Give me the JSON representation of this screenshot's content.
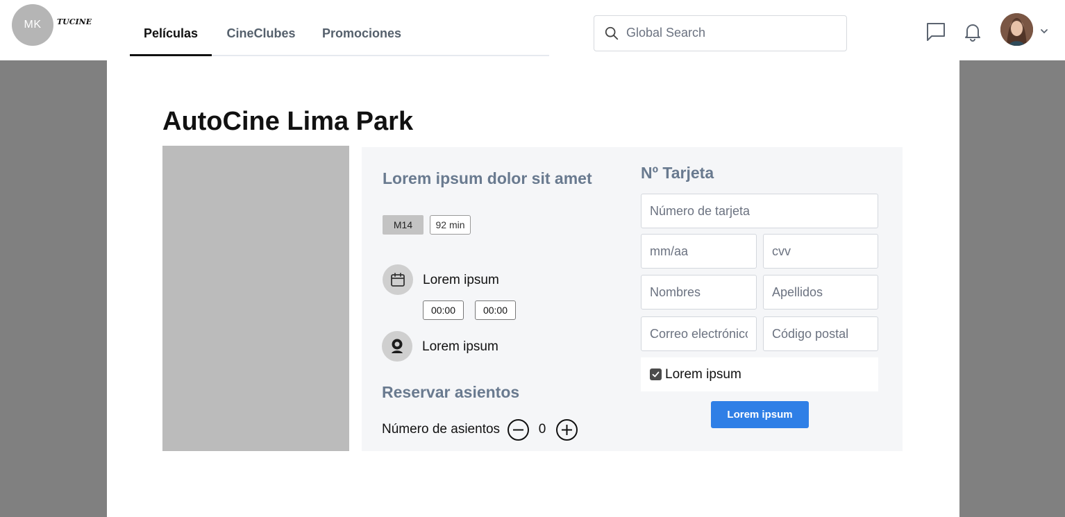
{
  "header": {
    "logo_initials": "MK",
    "brand": "TUCINE",
    "tabs": [
      {
        "label": "Películas",
        "active": true
      },
      {
        "label": "CineClubes",
        "active": false
      },
      {
        "label": "Promociones",
        "active": false
      }
    ],
    "search": {
      "placeholder": "Global Search",
      "icon": "search-icon"
    },
    "icons": [
      "chat-icon",
      "bell-icon",
      "chevron-down-icon"
    ]
  },
  "page": {
    "title": "AutoCine Lima Park"
  },
  "movie": {
    "title": "Lorem ipsum dolor sit amet",
    "rating": "M14",
    "duration": "92 min",
    "date_label": "Lorem ipsum",
    "times": [
      "00:00",
      "00:00"
    ],
    "location_label": "Lorem ipsum"
  },
  "seats": {
    "section_title": "Reservar asientos",
    "label": "Número de asientos",
    "count": "0"
  },
  "payment": {
    "title": "Nº Tarjeta",
    "card_number_placeholder": "Número de tarjeta",
    "expiry_placeholder": "mm/aa",
    "cvv_placeholder": "cvv",
    "first_name_placeholder": "Nombres",
    "last_name_placeholder": "Apellidos",
    "email_placeholder": "Correo electrónico",
    "postal_placeholder": "Código postal",
    "checkbox_label": "Lorem ipsum",
    "checkbox_checked": true,
    "submit_label": "Lorem ipsum"
  },
  "colors": {
    "accent": "#2f7fe6",
    "section_title": "#697a8f",
    "background": "#808080"
  }
}
